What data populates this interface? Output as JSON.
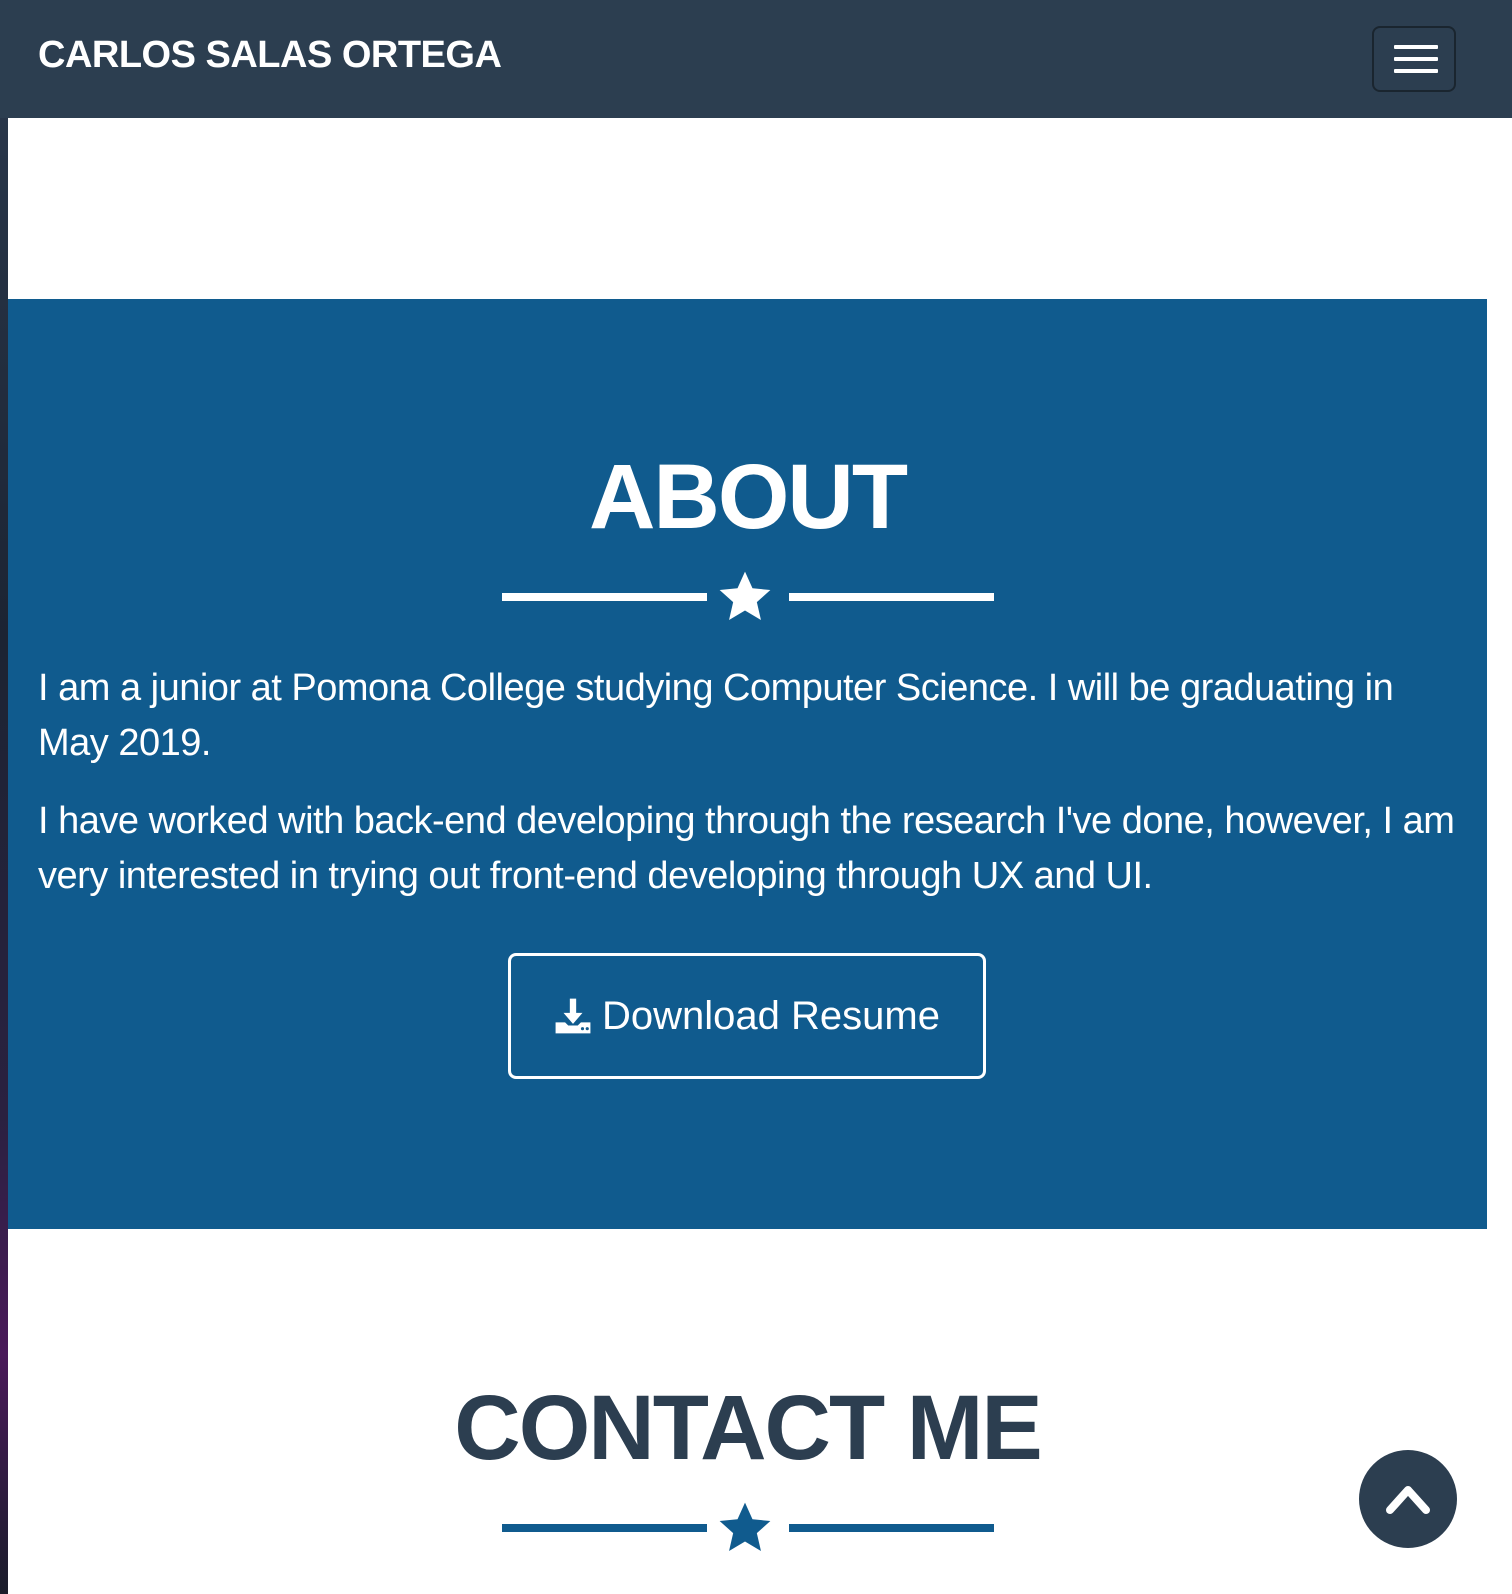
{
  "navbar": {
    "brand": "CARLOS SALAS ORTEGA",
    "menu_icon": "hamburger-menu-icon",
    "background": "#2c3e50"
  },
  "about": {
    "title": "ABOUT",
    "paragraphs": [
      "I am a junior at Pomona College studying Computer Science. I will be graduating in May 2019.",
      "I have worked with back-end developing through the research I've done, however, I am very interested in trying out front-end developing through UX and UI."
    ],
    "divider_icon": "star-icon",
    "download_button": {
      "label": "Download Resume",
      "icon": "download-icon"
    },
    "background": "#105b8e"
  },
  "contact": {
    "title": "CONTACT ME",
    "divider_icon": "star-icon"
  },
  "scroll_top": {
    "icon": "chevron-up-icon"
  }
}
